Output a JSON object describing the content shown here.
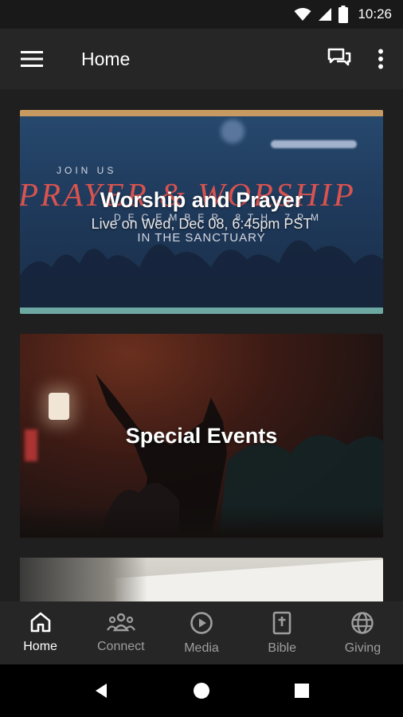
{
  "status": {
    "time": "10:26"
  },
  "appbar": {
    "title": "Home",
    "menu_icon": "hamburger-menu-icon",
    "chat_icon": "chat-icon",
    "more_icon": "more-vert-icon"
  },
  "feed": {
    "cards": [
      {
        "title": "Worship and Prayer",
        "subtitle": "Live on Wed, Dec 08, 6:45pm PST",
        "image_text": {
          "join": "JOIN US",
          "headline": "PRAYER & WORSHIP",
          "date": "DECEMBER 8TH 7PM",
          "location": "IN THE SANCTUARY"
        }
      },
      {
        "title": "Special Events"
      },
      {
        "title": ""
      }
    ]
  },
  "bottom_nav": {
    "items": [
      {
        "label": "Home",
        "icon": "home-icon",
        "active": true
      },
      {
        "label": "Connect",
        "icon": "group-icon",
        "active": false
      },
      {
        "label": "Media",
        "icon": "play-circle-icon",
        "active": false
      },
      {
        "label": "Bible",
        "icon": "bible-icon",
        "active": false
      },
      {
        "label": "Giving",
        "icon": "globe-icon",
        "active": false
      }
    ]
  },
  "system_nav": {
    "back": "back-icon",
    "home": "home-circle-icon",
    "recents": "recents-icon"
  }
}
